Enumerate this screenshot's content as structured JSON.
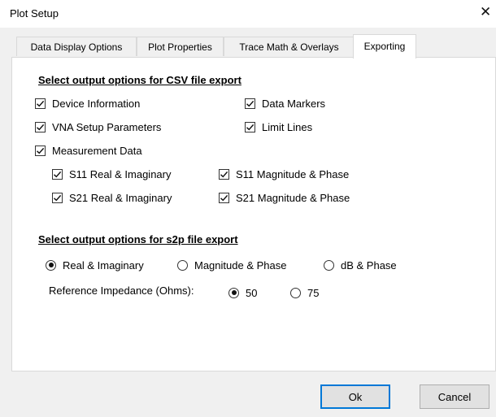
{
  "window": {
    "title": "Plot Setup",
    "close_glyph": "✕"
  },
  "tabs": [
    {
      "label": "Data Display Options",
      "active": false
    },
    {
      "label": "Plot Properties",
      "active": false
    },
    {
      "label": "Trace Math & Overlays",
      "active": false
    },
    {
      "label": "Exporting",
      "active": true
    }
  ],
  "csv_section": {
    "heading": "Select output options for CSV file export",
    "device_info": {
      "label": "Device Information",
      "checked": true
    },
    "data_markers": {
      "label": "Data Markers",
      "checked": true
    },
    "vna_setup": {
      "label": "VNA Setup Parameters",
      "checked": true
    },
    "limit_lines": {
      "label": "Limit Lines",
      "checked": true
    },
    "measurement_data": {
      "label": "Measurement Data",
      "checked": true
    },
    "s11_real_imag": {
      "label": "S11 Real & Imaginary",
      "checked": true
    },
    "s11_mag_phase": {
      "label": "S11 Magnitude & Phase",
      "checked": true
    },
    "s21_real_imag": {
      "label": "S21 Real & Imaginary",
      "checked": true
    },
    "s21_mag_phase": {
      "label": "S21 Magnitude & Phase",
      "checked": true
    }
  },
  "s2p_section": {
    "heading": "Select output options for s2p file export",
    "format_options": [
      {
        "label": "Real & Imaginary",
        "selected": true
      },
      {
        "label": "Magnitude & Phase",
        "selected": false
      },
      {
        "label": "dB & Phase",
        "selected": false
      }
    ],
    "impedance_label": "Reference Impedance (Ohms):",
    "impedance_options": [
      {
        "label": "50",
        "selected": true
      },
      {
        "label": "75",
        "selected": false
      }
    ]
  },
  "buttons": {
    "ok": "Ok",
    "cancel": "Cancel"
  },
  "colors": {
    "focus_border": "#0078d7",
    "panel_bg": "#ffffff",
    "dialog_bg": "#f0f0f0"
  }
}
